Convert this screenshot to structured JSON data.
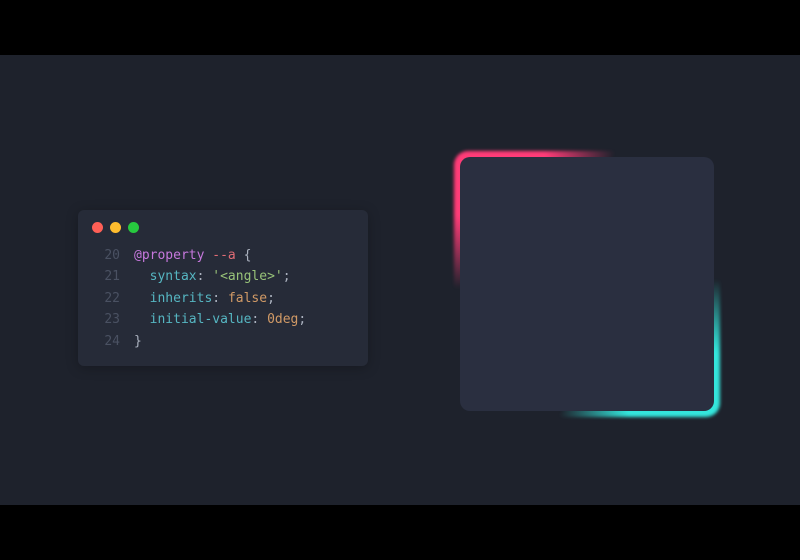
{
  "colors": {
    "stage_bg": "#1e222c",
    "editor_bg": "#262b38",
    "demo_fill": "#2a2f40",
    "traffic_red": "#ff5f56",
    "traffic_yellow": "#ffbd2e",
    "traffic_green": "#27c93f",
    "accent_pink": "#ff3c78",
    "accent_cyan": "#34e6dc"
  },
  "code": {
    "lines": [
      {
        "num": "20",
        "tokens": {
          "at_rule": "@property",
          "space1": " ",
          "name": "--a",
          "space2": " ",
          "brace": "{"
        }
      },
      {
        "num": "21",
        "tokens": {
          "indent": "  ",
          "prop": "syntax",
          "colon": ": ",
          "value": "'<angle>'",
          "semi": ";"
        }
      },
      {
        "num": "22",
        "tokens": {
          "indent": "  ",
          "prop": "inherits",
          "colon": ": ",
          "value": "false",
          "semi": ";"
        }
      },
      {
        "num": "23",
        "tokens": {
          "indent": "  ",
          "prop": "initial-value",
          "colon": ": ",
          "value": "0deg",
          "semi": ";"
        }
      },
      {
        "num": "24",
        "tokens": {
          "brace": "}"
        }
      }
    ]
  }
}
